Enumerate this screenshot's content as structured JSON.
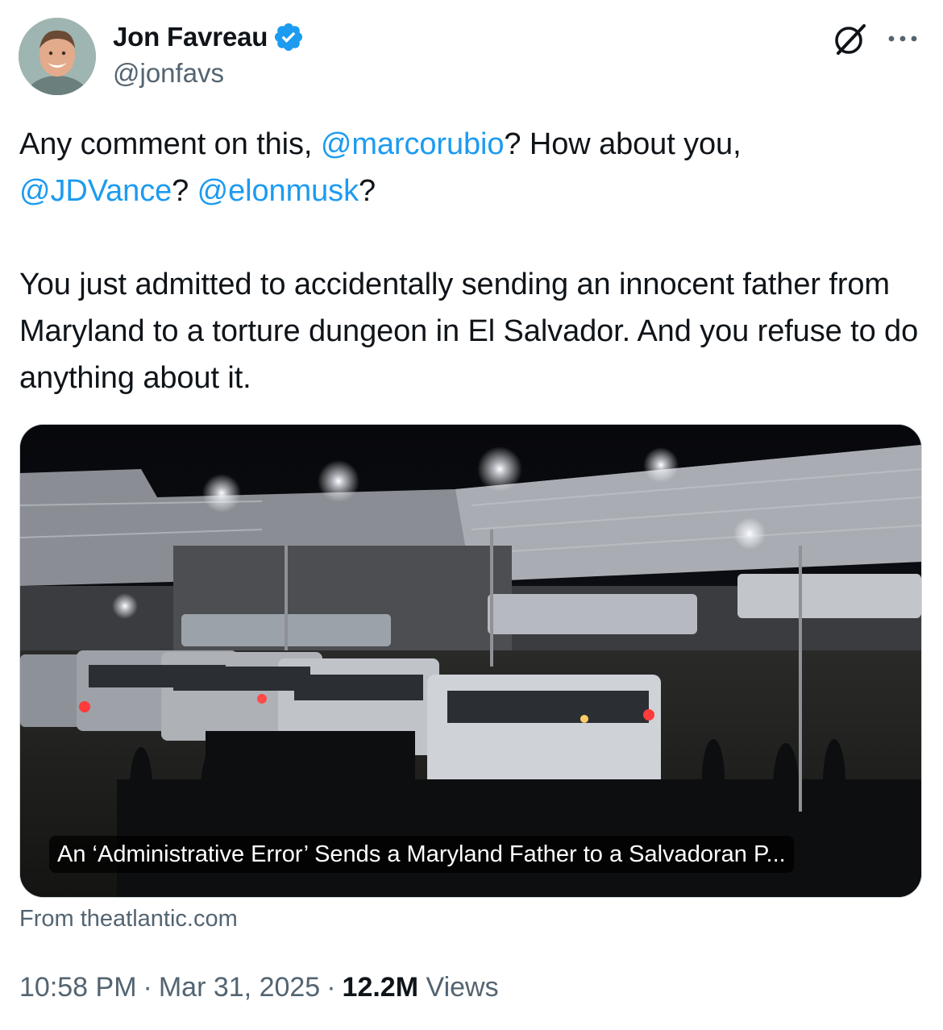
{
  "author": {
    "name": "Jon Favreau",
    "handle": "@jonfavs",
    "verified": true
  },
  "tweet": {
    "segments_p1": [
      {
        "text": "Any comment on this, ",
        "mention": false
      },
      {
        "text": "@marcorubio",
        "mention": true
      },
      {
        "text": "? How about you, ",
        "mention": false
      },
      {
        "text": "@JDVance",
        "mention": true
      },
      {
        "text": "? ",
        "mention": false
      },
      {
        "text": "@elonmusk",
        "mention": true
      },
      {
        "text": "?",
        "mention": false
      }
    ],
    "p2": "You just admitted to accidentally sending an innocent father from Maryland to a torture dungeon in El Salvador. And you refuse to do anything about it."
  },
  "card": {
    "title": "An ‘Administrative Error’ Sends a Maryland Father to a Salvadoran P...",
    "source": "From theatlantic.com"
  },
  "meta": {
    "time": "10:58 PM",
    "separator": "·",
    "date": "Mar 31, 2025",
    "views_count": "12.2M",
    "views_label": "Views"
  },
  "icons": [
    "verified-badge-icon",
    "grok-icon",
    "more-icon"
  ],
  "colors": {
    "accent": "#1d9bf0",
    "secondary_text": "#536471",
    "primary_text": "#0f1419"
  }
}
